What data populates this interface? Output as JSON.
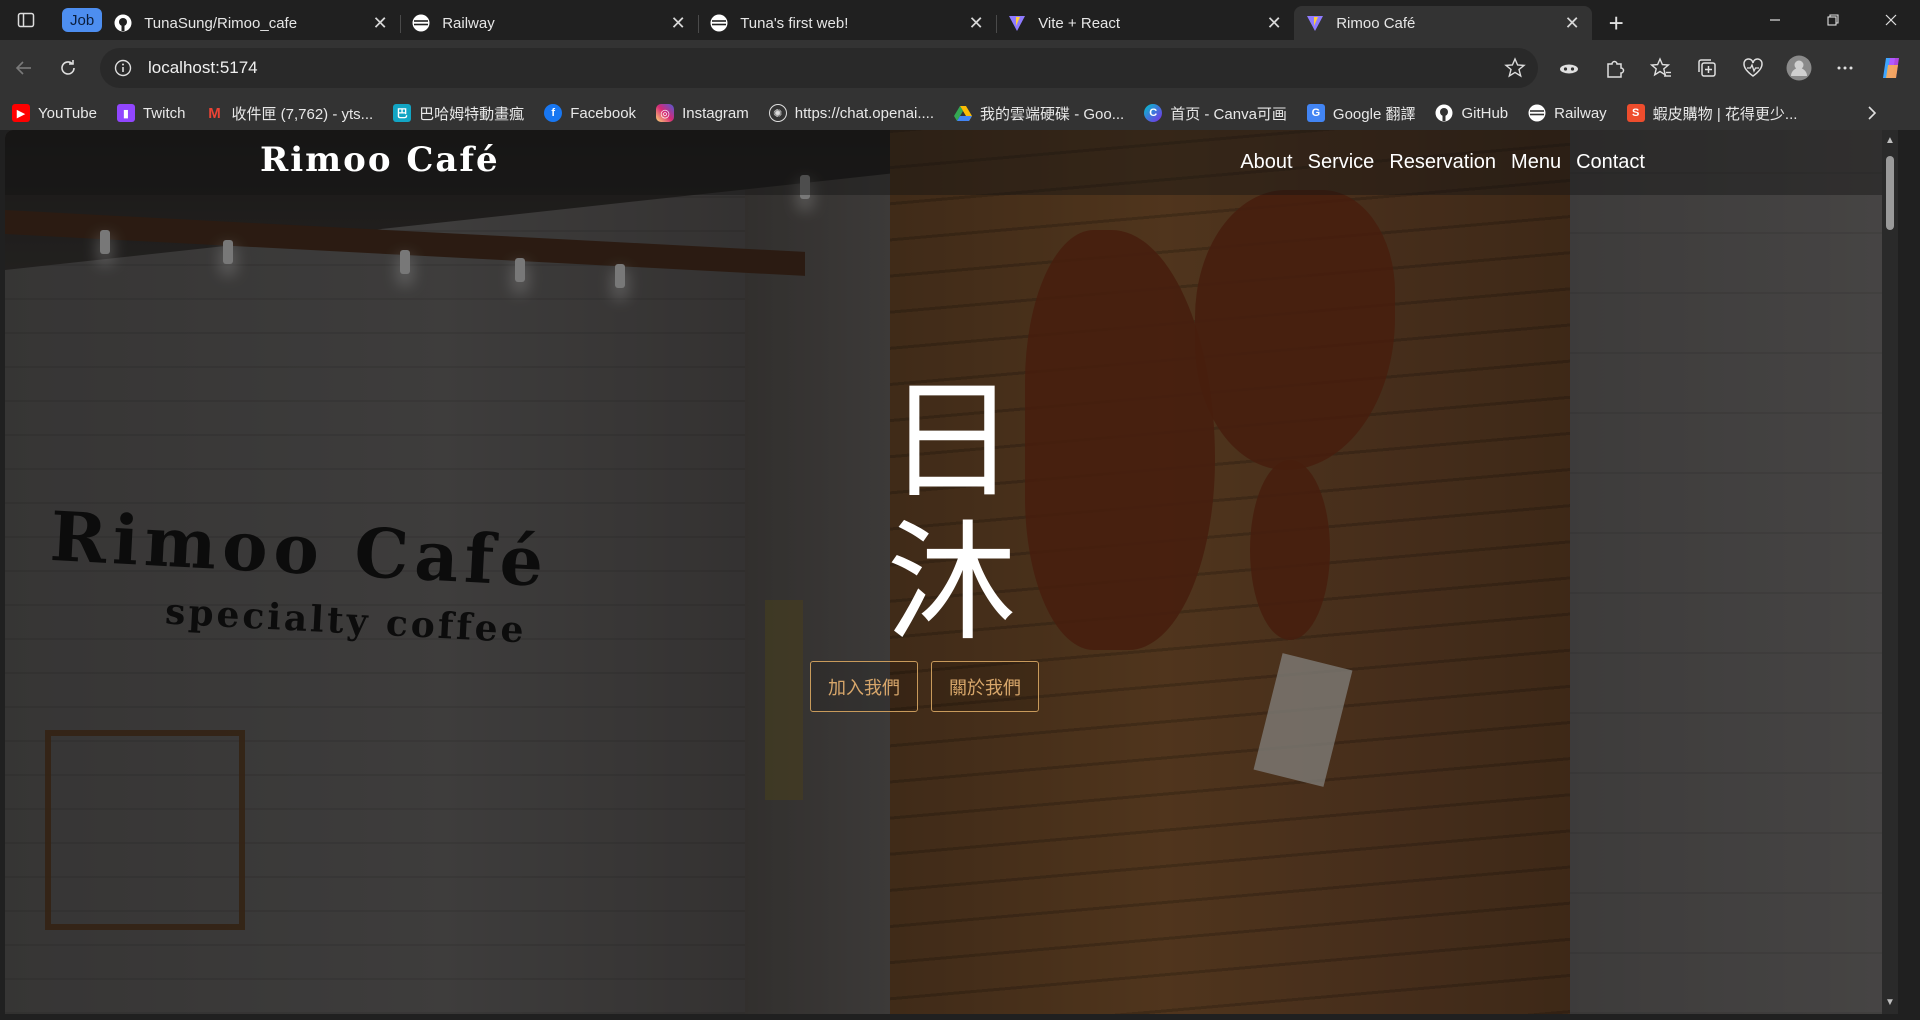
{
  "browser": {
    "tab_group_label": "Job",
    "tabs": [
      {
        "title": "TunaSung/Rimoo_cafe",
        "icon": "github-icon"
      },
      {
        "title": "Railway",
        "icon": "railway-icon"
      },
      {
        "title": "Tuna's first web!",
        "icon": "railway-icon"
      },
      {
        "title": "Vite + React",
        "icon": "vite-icon"
      },
      {
        "title": "Rimoo Café",
        "icon": "vite-icon",
        "active": true
      }
    ],
    "url": "localhost:5174",
    "bookmarks": [
      {
        "label": "YouTube",
        "icon": "youtube-icon",
        "color": "#ff0000"
      },
      {
        "label": "Twitch",
        "icon": "twitch-icon",
        "color": "#9146ff"
      },
      {
        "label": "收件匣 (7,762) - yts...",
        "icon": "gmail-icon",
        "color": "#ea4335"
      },
      {
        "label": "巴哈姆特動畫瘋",
        "icon": "bahamut-icon",
        "color": "#12a5c4"
      },
      {
        "label": "Facebook",
        "icon": "facebook-icon",
        "color": "#1877f2"
      },
      {
        "label": "Instagram",
        "icon": "instagram-icon",
        "color": "#d62976"
      },
      {
        "label": "https://chat.openai....",
        "icon": "openai-icon",
        "color": "#ffffff"
      },
      {
        "label": "我的雲端硬碟 - Goo...",
        "icon": "google-drive-icon",
        "color": "#34a853"
      },
      {
        "label": "首页 - Canva可画",
        "icon": "canva-icon",
        "color": "#7d2ae8"
      },
      {
        "label": "Google 翻譯",
        "icon": "google-translate-icon",
        "color": "#4285f4"
      },
      {
        "label": "GitHub",
        "icon": "github-icon",
        "color": "#ffffff"
      },
      {
        "label": "Railway",
        "icon": "railway-icon",
        "color": "#ffffff"
      },
      {
        "label": "蝦皮購物 | 花得更少...",
        "icon": "shopee-icon",
        "color": "#ee4d2d"
      }
    ]
  },
  "site": {
    "logo": "Rimoo Café",
    "nav": [
      "About",
      "Service",
      "Reservation",
      "Menu",
      "Contact"
    ],
    "hero": {
      "glyph_1": "日",
      "glyph_2": "沐",
      "buttons": [
        "加入我們",
        "關於我們"
      ],
      "button_color": "#c89a5b"
    },
    "background_sign": {
      "line_1": "Rimoo Café",
      "line_2": "specialty coffee"
    }
  }
}
